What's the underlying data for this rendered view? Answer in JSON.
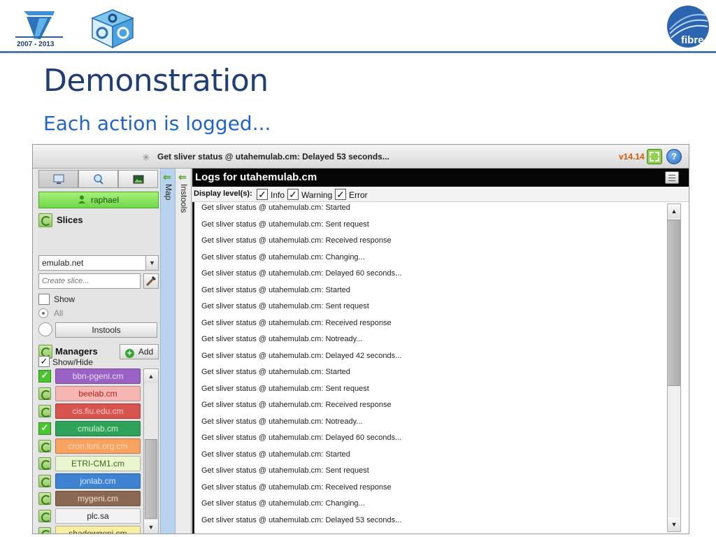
{
  "slide": {
    "title": "Demonstration",
    "subtitle": "Each action is logged...",
    "fp7_logo_text": "2007 - 2013",
    "fibre_logo_text": "fibre",
    "rule_color": "#4f78ad"
  },
  "app": {
    "status_text": "Get sliver status @ utahemulab.cm: Delayed 53 seconds...",
    "version": "v14.14",
    "help_label": "?",
    "sidebar": {
      "tabs": [
        "computer-icon",
        "search-icon",
        "photo-icon"
      ],
      "user": "raphael",
      "slices_label": "Slices",
      "selected_slice_authority": "emulab.net",
      "create_slice_placeholder": "Create slice...",
      "show_label": "Show",
      "all_label": "All",
      "instools_button": "Instools",
      "managers_label": "Managers",
      "add_button": "Add",
      "show_hide_label": "Show/Hide",
      "managers": [
        {
          "name": "bbn-pgeni.cm",
          "state": "checked",
          "bg": "#9a62c4",
          "fg": "#e9dbf4"
        },
        {
          "name": "beelab.cm",
          "state": "refresh",
          "bg": "#f6b7b4",
          "fg": "#b2201a"
        },
        {
          "name": "cis.fiu.edu.cm",
          "state": "refresh",
          "bg": "#d8544f",
          "fg": "#f4c9c6"
        },
        {
          "name": "cmulab.cm",
          "state": "checked",
          "bg": "#2fa25a",
          "fg": "#d7f5df"
        },
        {
          "name": "cron.loni.org.cm",
          "state": "refresh",
          "bg": "#f7a25e",
          "fg": "#fbd9b8"
        },
        {
          "name": "ETRI-CM1.cm",
          "state": "refresh",
          "bg": "#e9f6cf",
          "fg": "#3b6a12"
        },
        {
          "name": "jonlab.cm",
          "state": "refresh",
          "bg": "#3e83d1",
          "fg": "#d7e8fb"
        },
        {
          "name": "mygeni.cm",
          "state": "refresh",
          "bg": "#8a6852",
          "fg": "#f3e2d3"
        },
        {
          "name": "plc.sa",
          "state": "refresh",
          "bg": "#f2f2f2",
          "fg": "#222222"
        },
        {
          "name": "shadowgeni.cm",
          "state": "refresh",
          "bg": "#f7efa4",
          "fg": "#4a4010"
        }
      ]
    },
    "side_tabs": {
      "map": "Map",
      "instools": "Instools"
    },
    "logs": {
      "title": "Logs for utahemulab.cm",
      "levels_label": "Display level(s):",
      "levels": [
        "Info",
        "Warning",
        "Error"
      ],
      "lines": [
        "Get sliver status @ utahemulab.cm: Started",
        "Get sliver status @ utahemulab.cm: Sent request",
        "Get sliver status @ utahemulab.cm: Received response",
        "Get sliver status @ utahemulab.cm: Changing...",
        "Get sliver status @ utahemulab.cm: Delayed 60 seconds...",
        "Get sliver status @ utahemulab.cm: Started",
        "Get sliver status @ utahemulab.cm: Sent request",
        "Get sliver status @ utahemulab.cm: Received response",
        "Get sliver status @ utahemulab.cm: Notready...",
        "Get sliver status @ utahemulab.cm: Delayed 42 seconds...",
        "Get sliver status @ utahemulab.cm: Started",
        "Get sliver status @ utahemulab.cm: Sent request",
        "Get sliver status @ utahemulab.cm: Received response",
        "Get sliver status @ utahemulab.cm: Notready...",
        "Get sliver status @ utahemulab.cm: Delayed 60 seconds...",
        "Get sliver status @ utahemulab.cm: Started",
        "Get sliver status @ utahemulab.cm: Sent request",
        "Get sliver status @ utahemulab.cm: Received response",
        "Get sliver status @ utahemulab.cm: Changing...",
        "Get sliver status @ utahemulab.cm: Delayed 53 seconds..."
      ]
    }
  }
}
